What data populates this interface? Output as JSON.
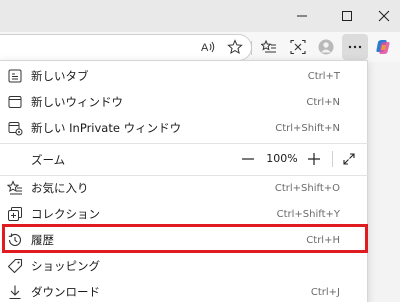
{
  "titlebar": {
    "minimize_icon": "minimize-icon",
    "maximize_icon": "maximize-icon",
    "close_icon": "close-icon"
  },
  "toolbar": {
    "icons": [
      "read-aloud-icon",
      "favorite-star-icon",
      "favorites-bar-icon",
      "screenshot-icon",
      "profile-icon",
      "more-dots-icon",
      "copilot-icon"
    ]
  },
  "menu": {
    "new_tab": {
      "label": "新しいタブ",
      "shortcut": "Ctrl+T"
    },
    "new_window": {
      "label": "新しいウィンドウ",
      "shortcut": "Ctrl+N"
    },
    "new_inprivate": {
      "label": "新しい InPrivate ウィンドウ",
      "shortcut": "Ctrl+Shift+N"
    },
    "zoom": {
      "label": "ズーム",
      "value": "100%"
    },
    "favorites": {
      "label": "お気に入り",
      "shortcut": "Ctrl+Shift+O"
    },
    "collections": {
      "label": "コレクション",
      "shortcut": "Ctrl+Shift+Y"
    },
    "history": {
      "label": "履歴",
      "shortcut": "Ctrl+H"
    },
    "shopping": {
      "label": "ショッピング",
      "shortcut": ""
    },
    "downloads": {
      "label": "ダウンロード",
      "shortcut": "Ctrl+J"
    }
  },
  "colors": {
    "highlight": "#e11b22",
    "copilot_accent": "#2b7cd3"
  }
}
